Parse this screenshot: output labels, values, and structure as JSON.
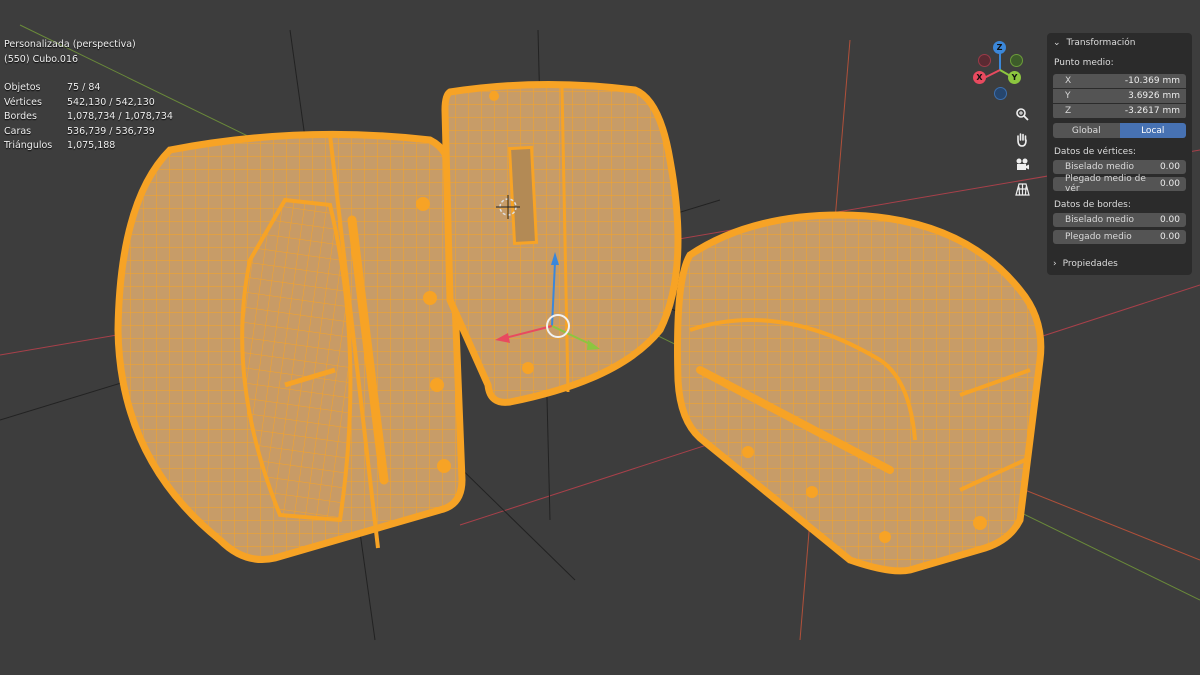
{
  "viewport": {
    "view_name": "Personalizada (perspectiva)",
    "active_object": "(550) Cubo.016",
    "stats": [
      {
        "label": "Objetos",
        "value": "75 / 84"
      },
      {
        "label": "Vértices",
        "value": "542,130 / 542,130"
      },
      {
        "label": "Bordes",
        "value": "1,078,734 / 1,078,734"
      },
      {
        "label": "Caras",
        "value": "536,739 / 536,739"
      },
      {
        "label": "Triángulos",
        "value": "1,075,188"
      }
    ]
  },
  "gizmo": {
    "x_label": "X",
    "y_label": "Y",
    "z_label": "Z",
    "colors": {
      "x": "#e84a5f",
      "y": "#8cc63f",
      "z": "#3b87d9"
    }
  },
  "tools": [
    "zoom-icon",
    "hand-pan-icon",
    "camera-icon",
    "grid-perspective-icon"
  ],
  "npanel": {
    "transform_header": "Transformación",
    "median_label": "Punto medio:",
    "x": {
      "label": "X",
      "value": "-10.369 mm"
    },
    "y": {
      "label": "Y",
      "value": "3.6926 mm"
    },
    "z": {
      "label": "Z",
      "value": "-3.2617 mm"
    },
    "global_label": "Global",
    "local_label": "Local",
    "vertex_data_label": "Datos de vértices:",
    "mean_bevel_vertex": {
      "label": "Biselado medio",
      "value": "0.00"
    },
    "mean_crease_vertex": {
      "label": "Plegado medio de vér",
      "value": "0.00"
    },
    "edge_data_label": "Datos de bordes:",
    "mean_bevel_edge": {
      "label": "Biselado medio",
      "value": "0.00"
    },
    "mean_crease_edge": {
      "label": "Plegado medio",
      "value": "0.00"
    },
    "properties_header": "Propiedades"
  },
  "colors": {
    "background": "#3d3d3d",
    "wire": "#f5a623",
    "fill": "#c99a63",
    "active_toggle": "#4772b3"
  }
}
